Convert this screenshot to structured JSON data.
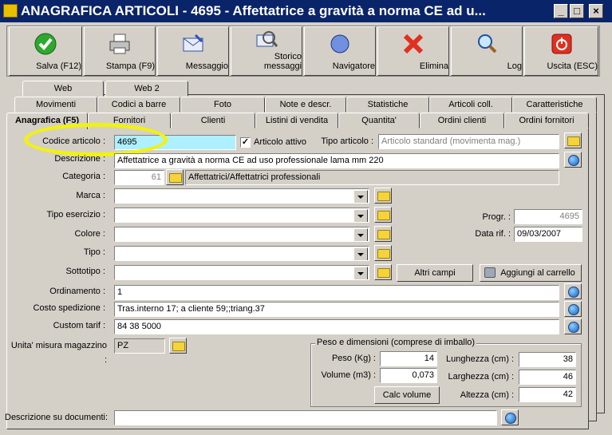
{
  "window": {
    "title": "ANAGRAFICA ARTICOLI - 4695 - Affettatrice a gravità a norma CE ad u...",
    "min_symbol": "_",
    "max_symbol": "□",
    "close_symbol": "×"
  },
  "toolbar": {
    "save": "Salva (F12)",
    "print": "Stampa (F9)",
    "message": "Messaggio",
    "history_l1": "Storico",
    "history_l2": "messaggi",
    "navigator": "Navigatore",
    "delete": "Elimina",
    "log": "Log",
    "exit": "Uscita (ESC)"
  },
  "tabs": {
    "row1": [
      "Web",
      "Web 2"
    ],
    "row2": [
      "Movimenti",
      "Codici a barre",
      "Foto",
      "Note e descr.",
      "Statistiche",
      "Articoli coll.",
      "Caratteristiche"
    ],
    "row3": [
      "Anagrafica (F5)",
      "Fornitori",
      "Clienti",
      "Listini di vendita",
      "Quantita'",
      "Ordini clienti",
      "Ordini fornitori"
    ]
  },
  "form": {
    "code_label": "Codice articolo :",
    "code_value": "4695",
    "active_label": "Articolo attivo",
    "active_checked": "✓",
    "type_label": "Tipo articolo :",
    "type_value": "Articolo standard (movimenta mag.)",
    "desc_label": "Descrizione :",
    "desc_value": "Affettatrice a gravità a norma CE ad uso professionale lama mm 220",
    "cat_label": "Categoria :",
    "cat_code": "61",
    "cat_value": "Affettatrici/Affettatrici professionali",
    "brand_label": "Marca :",
    "exercise_label": "Tipo esercizio :",
    "color_label": "Colore :",
    "tipo_label": "Tipo :",
    "subtype_label": "Sottotipo :",
    "progr_label": "Progr. :",
    "progr_value": "4695",
    "date_label": "Data rif. :",
    "date_value": "09/03/2007",
    "other_fields": "Altri campi",
    "add_cart": "Aggiungi al carrello",
    "order_label": "Ordinamento :",
    "order_value": "1",
    "shipping_label": "Costo spedizione :",
    "shipping_value": "Tras.interno 17; a cliente 59;;triang.37",
    "tariff_label": "Custom tarif :",
    "tariff_value": "84 38 5000",
    "unit_label": "Unita' misura magazzino :",
    "unit_value": "PZ",
    "dims_title": "Peso e dimensioni (comprese di imballo)",
    "weight_label": "Peso (Kg) :",
    "weight_value": "14",
    "volume_label": "Volume (m3) :",
    "volume_value": "0,073",
    "calc_volume": "Calc volume",
    "length_label": "Lunghezza (cm) :",
    "length_value": "38",
    "width_label": "Larghezza (cm) :",
    "width_value": "46",
    "height_label": "Altezza (cm) :",
    "height_value": "42",
    "docdesc_label": "Descrizione su documenti:"
  }
}
